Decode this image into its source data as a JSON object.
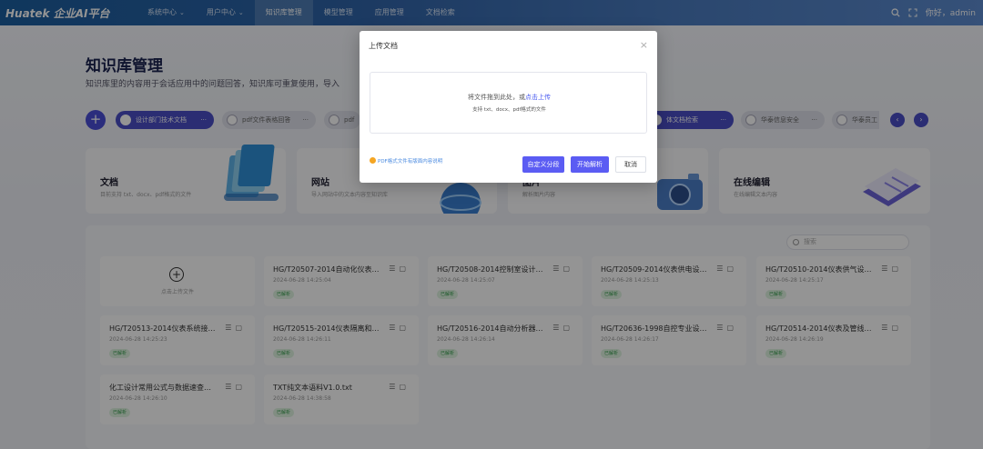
{
  "app": {
    "logo": "Huatek 企业AI平台"
  },
  "nav": [
    {
      "label": "系统中心",
      "dropdown": true,
      "active": false
    },
    {
      "label": "用户中心",
      "dropdown": true,
      "active": false
    },
    {
      "label": "知识库管理",
      "dropdown": false,
      "active": true
    },
    {
      "label": "模型管理",
      "dropdown": false,
      "active": false
    },
    {
      "label": "应用管理",
      "dropdown": false,
      "active": false
    },
    {
      "label": "文档检索",
      "dropdown": false,
      "active": false
    }
  ],
  "header_right": {
    "greeting": "你好，admin"
  },
  "page": {
    "title": "知识库管理",
    "description": "知识库里的内容用于会话应用中的问题回答，知识库可重复使用，导入"
  },
  "knowledge_chips": [
    {
      "label": "设计部门技术文档",
      "active": true
    },
    {
      "label": "pdf文件表格回答",
      "active": false
    },
    {
      "label": "pdf",
      "active": false
    },
    {
      "label": "…",
      "active": false
    },
    {
      "label": "体文档检索",
      "active": true
    },
    {
      "label": "华泰信息安全",
      "active": false
    },
    {
      "label": "华泰员工",
      "active": false
    }
  ],
  "chip_more_glyph": "···",
  "type_cards": [
    {
      "title": "文档",
      "subtitle": "目前支持 txt、docx、pdf格式的文件"
    },
    {
      "title": "网站",
      "subtitle": "导入网站中的文本内容至知识库"
    },
    {
      "title": "图片",
      "subtitle": "解析图片内容"
    },
    {
      "title": "在线编辑",
      "subtitle": "在线编辑文本内容"
    }
  ],
  "search": {
    "placeholder": "搜索"
  },
  "upload_card": {
    "label": "点击上传文件"
  },
  "files": [
    {
      "name": "HG/T20507-2014自动化仪表选型设计规范",
      "date": "2024-06-28 14:25:04",
      "status": "已解析"
    },
    {
      "name": "HG/T20508-2014控制室设计规范",
      "date": "2024-06-28 14:25:07",
      "status": "已解析"
    },
    {
      "name": "HG/T20509-2014仪表供电设计规范",
      "date": "2024-06-28 14:25:13",
      "status": "已解析"
    },
    {
      "name": "HG/T20510-2014仪表供气设计规范",
      "date": "2024-06-28 14:25:17",
      "status": "已解析"
    },
    {
      "name": "HG/T20513-2014仪表系统接地设计规范",
      "date": "2024-06-28 14:25:23",
      "status": "已解析"
    },
    {
      "name": "HG/T20515-2014仪表隔离和吹洗设计规范",
      "date": "2024-06-28 14:26:11",
      "status": "已解析"
    },
    {
      "name": "HG/T20516-2014自动分析器室设计规范",
      "date": "2024-06-28 14:26:14",
      "status": "已解析"
    },
    {
      "name": "HG/T20636-1998自控专业设计管理规定",
      "date": "2024-06-28 14:26:17",
      "status": "已解析"
    },
    {
      "name": "HG/T20514-2014仪表及管线伴热和绝热保温设计规范",
      "date": "2024-06-28 14:26:19",
      "status": "已解析"
    },
    {
      "name": "化工设计常用公式与数据速查手册",
      "date": "2024-06-28 14:26:10",
      "status": "已解析"
    },
    {
      "name": "TXT纯文本语料V1.0.txt",
      "date": "2024-06-28 14:38:58",
      "status": "已解析"
    }
  ],
  "modal": {
    "title": "上传文档",
    "close_glyph": "×",
    "drop_text": "将文件拖到此处，或",
    "drop_link": "点击上传",
    "drop_support": "支持 txt、docx、pdf格式的文件",
    "hint": "PDF格式文件有版面内容说明",
    "buttons": {
      "custom_split": "自定义分段",
      "start_parse": "开始解析",
      "cancel": "取消"
    }
  },
  "colors": {
    "accent": "#5b5cf3",
    "nav_bg": "#2f63a8",
    "status_green": "#2f9a46"
  }
}
